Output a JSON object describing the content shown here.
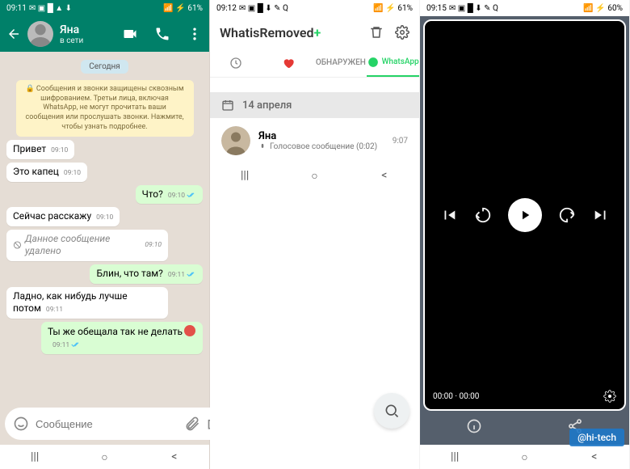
{
  "phone1": {
    "status": {
      "time": "09:11",
      "battery": "61%"
    },
    "header": {
      "name": "Яна",
      "status": "в сети"
    },
    "day_label": "Сегодня",
    "encryption_notice": "🔒 Сообщения и звонки защищены сквозным шифрованием. Третьи лица, включая WhatsApp, не могут прочитать ваши сообщения или прослушать звонки. Нажмите, чтобы узнать подробнее.",
    "messages": [
      {
        "dir": "in",
        "text": "Привет",
        "time": "09:10"
      },
      {
        "dir": "in",
        "text": "Это капец",
        "time": "09:10"
      },
      {
        "dir": "out",
        "text": "Что?",
        "time": "09:10"
      },
      {
        "dir": "in",
        "text": "Сейчас расскажу",
        "time": "09:10"
      },
      {
        "dir": "in",
        "text": "Данное сообщение удалено",
        "time": "09:10",
        "deleted": true
      },
      {
        "dir": "out",
        "text": "Блин, что там?",
        "time": "09:11"
      },
      {
        "dir": "in",
        "text": "Ладно, как нибудь лучше потом",
        "time": "09:11"
      },
      {
        "dir": "out",
        "text": "Ты же обещала так не делать",
        "time": "09:11",
        "emoji": "😡"
      }
    ],
    "input_placeholder": "Сообщение"
  },
  "phone2": {
    "status": {
      "time": "09:12",
      "battery": "61%"
    },
    "app_title": "WhatisRemoved",
    "tabs": {
      "detected": "ОБНАРУЖЕН",
      "whatsapp": "WhatsApp"
    },
    "date_header": "14 апреля",
    "item": {
      "name": "Яна",
      "subtitle": "Голосовое сообщение (0:02)",
      "time": "9:07"
    }
  },
  "phone3": {
    "status": {
      "time": "09:15",
      "battery": "60%"
    },
    "video": {
      "current": "00:00",
      "duration": "00:00"
    }
  },
  "watermark": "hi-tech"
}
